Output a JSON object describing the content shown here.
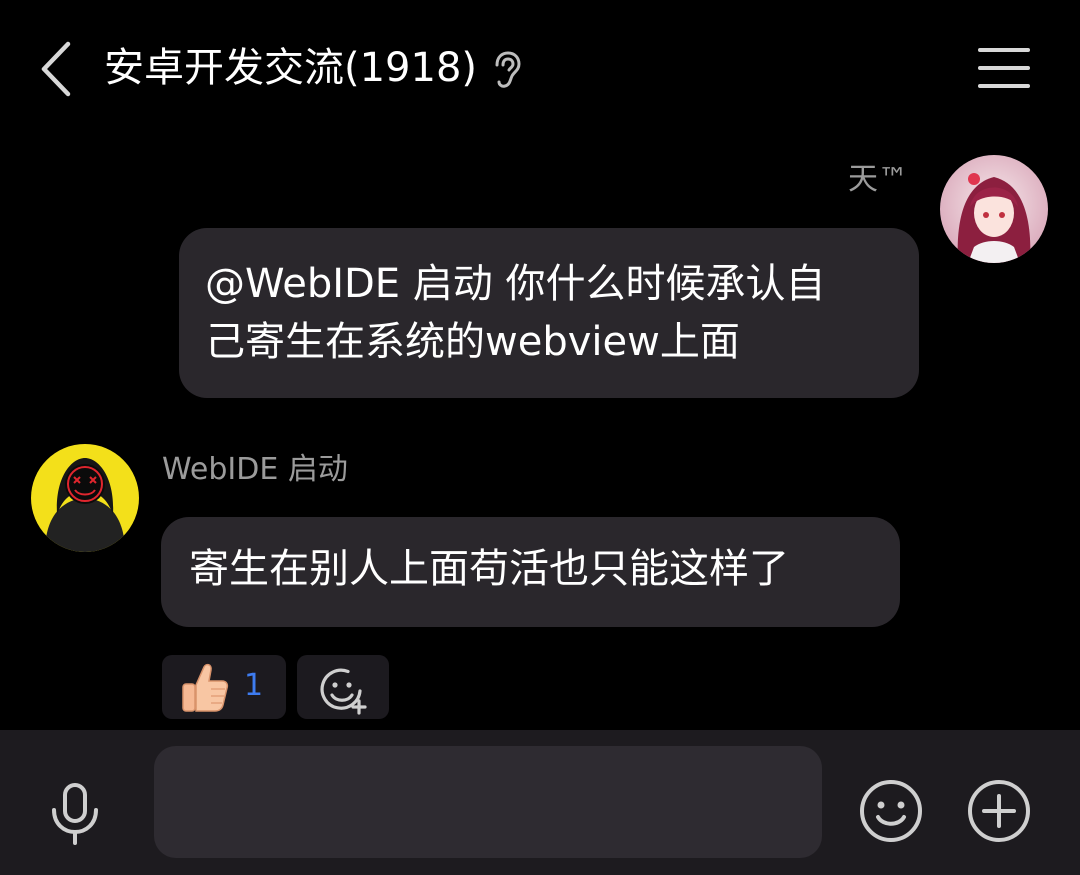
{
  "header": {
    "title": "安卓开发交流(1918)",
    "back_icon": "chevron-left-icon",
    "ear_icon": "ear-icon",
    "menu_icon": "hamburger-menu-icon"
  },
  "messages": [
    {
      "sender": "天™",
      "text": "@WebIDE 启动 你什么时候承认自己寄生在系统的webview上面",
      "text_line1": "@WebIDE 启动 你什么时候承认自",
      "text_line2": "己寄生在系统的webview上面",
      "is_self": true
    },
    {
      "sender": "WebIDE 启动",
      "text": "寄生在别人上面苟活也只能这样了",
      "is_self": false,
      "reactions": [
        {
          "emoji": "thumbs-up-icon",
          "count": "1"
        }
      ],
      "add_reaction_icon": "add-reaction-icon"
    }
  ],
  "input_bar": {
    "value": "",
    "placeholder": "",
    "mic_icon": "microphone-icon",
    "emoji_icon": "smiley-icon",
    "plus_icon": "plus-circle-icon"
  },
  "colors": {
    "background": "#000000",
    "bubble": "#2a272c",
    "input_bar": "#1d1b1f",
    "sender_name": "#9b9b9b",
    "reaction_count": "#3e7cf0"
  }
}
